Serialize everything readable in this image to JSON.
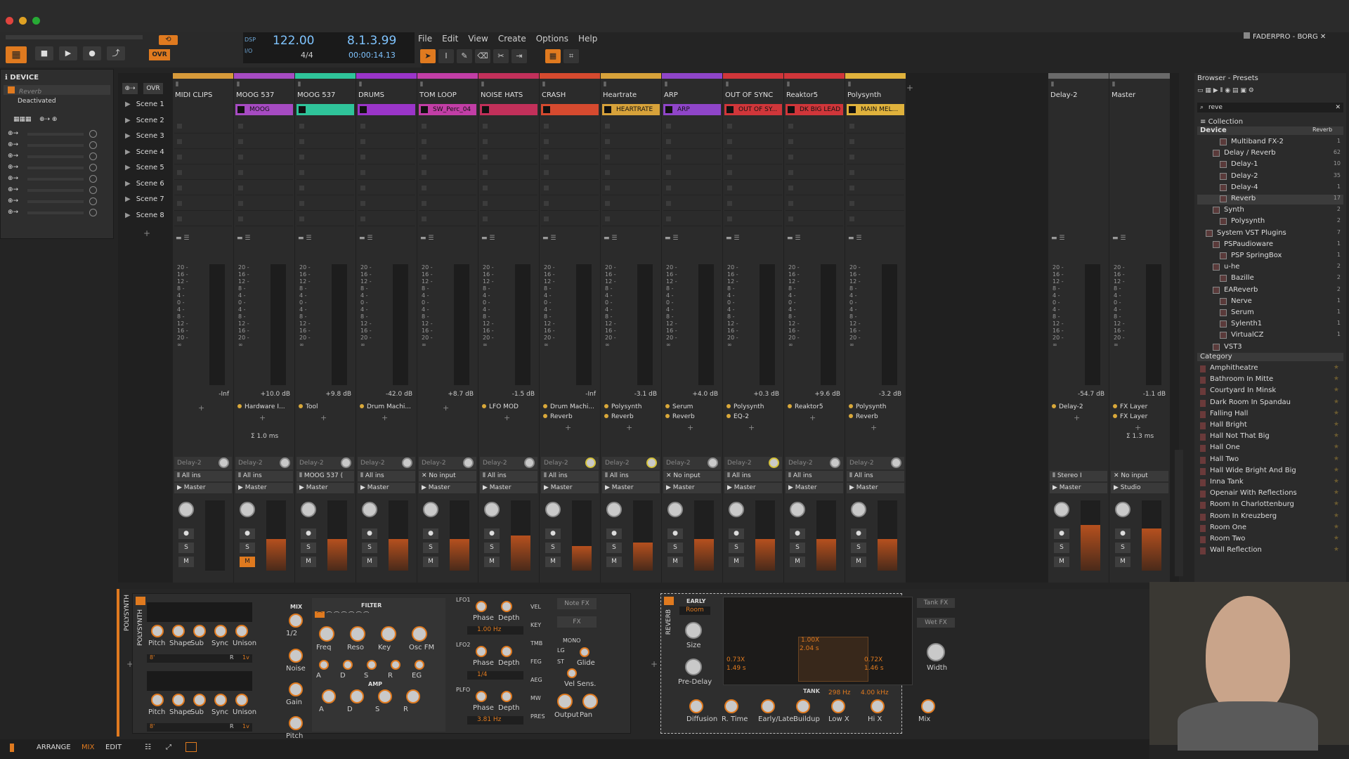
{
  "window": {
    "title": "FADERPRO - BORG"
  },
  "transport": {
    "bpm": "122.00",
    "time_sig": "4/4",
    "position": "8.1.3.99",
    "time": "00:00:14.13",
    "ovr": "OVR",
    "dsp_label": "DSP",
    "io_label": "I/O"
  },
  "menu": [
    "File",
    "Edit",
    "View",
    "Create",
    "Options",
    "Help"
  ],
  "device_panel": {
    "title": "DEVICE",
    "device_name": "Reverb",
    "status": "Deactivated"
  },
  "scenes": [
    "Scene 1",
    "Scene 2",
    "Scene 3",
    "Scene 4",
    "Scene 5",
    "Scene 6",
    "Scene 7",
    "Scene 8"
  ],
  "tracks": [
    {
      "name": "MIDI CLIPS",
      "color": "#d79a3a",
      "clip": "",
      "db": "-Inf",
      "dev1": "",
      "dev2": "",
      "send": "Delay-2",
      "input": "All ins",
      "output": "Master",
      "fill": 0.0
    },
    {
      "name": "MOOG 537",
      "color": "#a64bc2",
      "clip": "MOOG",
      "db": "+10.0 dB",
      "dev1": "Hardware I...",
      "dev2": "",
      "send": "Delay-2",
      "input": "All ins",
      "output": "Master",
      "fill": 0.45,
      "mute": true,
      "latency": "Σ 1.0 ms"
    },
    {
      "name": "MOOG 537",
      "color": "#2fc49a",
      "clip": "",
      "db": "+9.8 dB",
      "dev1": "Tool",
      "dev2": "",
      "send": "Delay-2",
      "input": "MOOG 537 (",
      "output": "Master",
      "fill": 0.45
    },
    {
      "name": "DRUMS",
      "color": "#9a35c9",
      "clip": "",
      "db": "-42.0 dB",
      "dev1": "Drum Machi...",
      "dev2": "",
      "send": "Delay-2",
      "input": "All ins",
      "output": "Master",
      "fill": 0.45
    },
    {
      "name": "TOM LOOP",
      "color": "#c23ea6",
      "clip": "SW_Perc_04",
      "db": "+8.7 dB",
      "dev1": "",
      "dev2": "",
      "send": "Delay-2",
      "input": "No input",
      "output": "Master",
      "fill": 0.45
    },
    {
      "name": "NOISE HATS",
      "color": "#c2305a",
      "clip": "",
      "db": "-1.5 dB",
      "dev1": "LFO MOD",
      "dev2": "",
      "send": "Delay-2",
      "input": "All ins",
      "output": "Master",
      "fill": 0.5
    },
    {
      "name": "CRASH",
      "color": "#d64a2f",
      "clip": "",
      "db": "-Inf",
      "dev1": "Drum Machi...",
      "dev2": "Reverb",
      "send": "Delay-2",
      "input": "All ins",
      "output": "Master",
      "fill": 0.35
    },
    {
      "name": "Heartrate",
      "color": "#d7a23a",
      "clip": "HEARTRATE",
      "db": "-3.1 dB",
      "dev1": "Polysynth",
      "dev2": "Reverb",
      "send": "Delay-2",
      "input": "All ins",
      "output": "Master",
      "fill": 0.4
    },
    {
      "name": "ARP",
      "color": "#8f45c9",
      "clip": "ARP",
      "db": "+4.0 dB",
      "dev1": "Serum",
      "dev2": "Reverb",
      "send": "Delay-2",
      "input": "No input",
      "output": "Master",
      "fill": 0.45
    },
    {
      "name": "OUT OF SYNC",
      "color": "#d0363a",
      "clip": "OUT OF SY...",
      "db": "+0.3 dB",
      "dev1": "Polysynth",
      "dev2": "EQ-2",
      "send": "Delay-2",
      "input": "All ins",
      "output": "Master",
      "fill": 0.45
    },
    {
      "name": "Reaktor5",
      "color": "#d0363a",
      "clip": "DK BIG LEAD",
      "db": "+9.6 dB",
      "dev1": "Reaktor5",
      "dev2": "",
      "send": "Delay-2",
      "input": "All ins",
      "output": "Master",
      "fill": 0.45
    },
    {
      "name": "Polysynth",
      "color": "#e0b23c",
      "clip": "MAIN MEL...",
      "db": "-3.2 dB",
      "dev1": "Polysynth",
      "dev2": "Reverb",
      "send": "Delay-2",
      "input": "All ins",
      "output": "Master",
      "fill": 0.45
    }
  ],
  "fx_tracks": [
    {
      "name": "Delay-2",
      "db": "-54.7 dB",
      "dev1": "Delay-2",
      "dev2": "",
      "input": "Stereo I",
      "output": "Master",
      "fill": 0.65
    },
    {
      "name": "Master",
      "db": "-1.1 dB",
      "dev1": "FX Layer",
      "dev2": "FX Layer",
      "input": "No input",
      "output": "Studio",
      "fill": 0.6,
      "latency": "Σ 1.3 ms"
    }
  ],
  "meter_scale": [
    "20 -",
    "16 -",
    "12 -",
    "8 -",
    "4 -",
    "0 -",
    "4 -",
    "8 -",
    "12 -",
    "16 -",
    "20 -",
    "∞"
  ],
  "browser": {
    "title": "Browser - Presets",
    "search": "reve",
    "collection": "Collection",
    "device_header": "Device",
    "device_filter": "Reverb",
    "items": [
      {
        "label": "Multiband FX-2",
        "count": "1",
        "indent": 3
      },
      {
        "label": "Delay / Reverb",
        "count": "62",
        "indent": 2
      },
      {
        "label": "Delay-1",
        "count": "10",
        "indent": 3
      },
      {
        "label": "Delay-2",
        "count": "35",
        "indent": 3
      },
      {
        "label": "Delay-4",
        "count": "1",
        "indent": 3
      },
      {
        "label": "Reverb",
        "count": "17",
        "indent": 3
      },
      {
        "label": "Synth",
        "count": "2",
        "indent": 2
      },
      {
        "label": "Polysynth",
        "count": "2",
        "indent": 3
      },
      {
        "label": "System VST Plugins",
        "count": "7",
        "indent": 1
      },
      {
        "label": "PSPaudioware",
        "count": "1",
        "indent": 2
      },
      {
        "label": "PSP SpringBox",
        "count": "1",
        "indent": 3
      },
      {
        "label": "u-he",
        "count": "2",
        "indent": 2
      },
      {
        "label": "Bazille",
        "count": "2",
        "indent": 3
      },
      {
        "label": "EAReverb",
        "count": "2",
        "indent": 2
      },
      {
        "label": "Nerve",
        "count": "1",
        "indent": 3
      },
      {
        "label": "Serum",
        "count": "1",
        "indent": 3
      },
      {
        "label": "Sylenth1",
        "count": "1",
        "indent": 3
      },
      {
        "label": "VirtualCZ",
        "count": "1",
        "indent": 3
      },
      {
        "label": "VST3",
        "count": "",
        "indent": 2
      }
    ],
    "category": "Category",
    "presets": [
      "Amphitheatre",
      "Bathroom In Mitte",
      "Courtyard In Minsk",
      "Dark Room In Spandau",
      "Falling Hall",
      "Hall Bright",
      "Hall Not That Big",
      "Hall One",
      "Hall Two",
      "Hall Wide Bright And Big",
      "Inna Tank",
      "Openair With Reflections",
      "Room In Charlottenburg",
      "Room In Kreuzberg",
      "Room One",
      "Room Two",
      "Wall Reflection"
    ]
  },
  "polysynth": {
    "title": "POLYSYNTH",
    "osc_knobs": [
      "Pitch",
      "Shape",
      "Sub",
      "Sync",
      "Unison"
    ],
    "osc_vals": [
      "8'",
      "R",
      "1v"
    ],
    "mix": {
      "title": "MIX",
      "val": "1/2",
      "labels": [
        "Noise",
        "Gain",
        "Pitch"
      ]
    },
    "filter": {
      "title": "FILTER",
      "knobs": [
        "Freq",
        "Reso",
        "Key",
        "Osc FM"
      ],
      "env": [
        "A",
        "D",
        "S",
        "R",
        "EG"
      ]
    },
    "amp": {
      "title": "AMP",
      "knobs": [
        "A",
        "D",
        "S",
        "R"
      ]
    },
    "lfo1": {
      "title": "LFO1",
      "rate": "1.00 Hz",
      "knobs": [
        "Phase",
        "Depth"
      ]
    },
    "lfo2": {
      "title": "LFO2",
      "rate": "1/4",
      "knobs": [
        "Phase",
        "Depth"
      ]
    },
    "plfo": {
      "title": "PLFO",
      "rate": "3.81 Hz",
      "knobs": [
        "Phase",
        "Depth"
      ]
    },
    "mod": [
      "VEL",
      "KEY",
      "TMB",
      "FEG",
      "AEG",
      "MW",
      "PRES"
    ],
    "right": {
      "notefx": "Note FX",
      "fx": "FX",
      "mono": "MONO",
      "lg": "LG",
      "st": "ST",
      "glide": "Glide",
      "velsens": "Vel Sens.",
      "output": "Output",
      "pan": "Pan"
    }
  },
  "reverb": {
    "title": "REVERB",
    "early": "EARLY",
    "room": "Room",
    "size": "Size",
    "predelay": "Pre-Delay",
    "graph_vals": [
      "1.00X",
      "2.04 s",
      "0.73X",
      "1.49 s",
      "0.72X",
      "1.46 s"
    ],
    "tank": "TANK",
    "tank_hz1": "298 Hz",
    "tank_hz2": "4.00 kHz",
    "tankfx": "Tank FX",
    "wetfx": "Wet FX",
    "width": "Width",
    "bottom_knobs": [
      "Diffusion",
      "R. Time",
      "Early/Late",
      "Buildup",
      "Low X",
      "Hi X",
      "Mix"
    ]
  },
  "statusbar": {
    "arrange": "ARRANGE",
    "mix": "MIX",
    "edit": "EDIT"
  },
  "colors": {
    "accent": "#e07a1f",
    "bg": "#242424"
  }
}
